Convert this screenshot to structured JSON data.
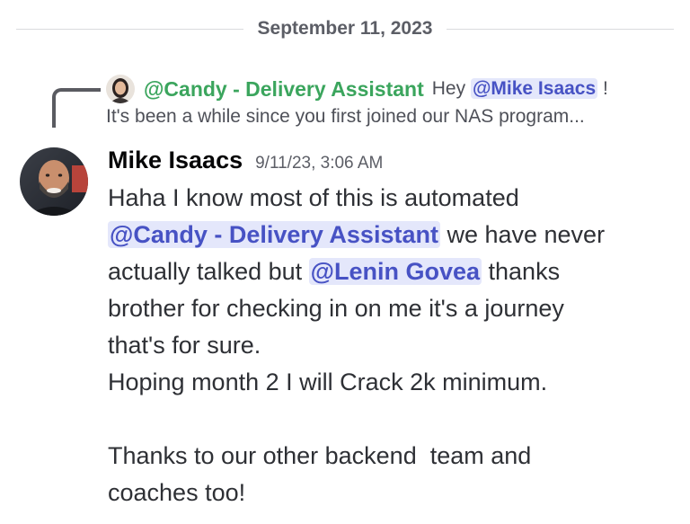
{
  "divider": {
    "date": "September 11, 2023"
  },
  "reply": {
    "author": "@Candy - Delivery Assistant",
    "text_before": "Hey ",
    "mention": "@Mike Isaacs",
    "text_after": " !",
    "line2": "It's been a while since you first joined our NAS program..."
  },
  "message": {
    "username": "Mike Isaacs",
    "timestamp": "9/11/23, 3:06 AM",
    "line1": "Haha I know most of this is automated",
    "mention1": "@Candy - Delivery Assistant",
    "line2_after": " we have never",
    "line3_before": "actually talked but ",
    "mention2": "@Lenin Govea",
    "line3_after": " thanks",
    "line4": "brother for checking in on me it's a journey",
    "line5": "that's for sure.",
    "line6": "Hoping month 2 I will Crack 2k minimum.",
    "line8": "Thanks to our other backend  team and",
    "line9": "coaches too!"
  },
  "colors": {
    "bot_name": "#3ba55d",
    "mention_bg": "#e4e7fb",
    "mention_text": "#4752c4"
  }
}
